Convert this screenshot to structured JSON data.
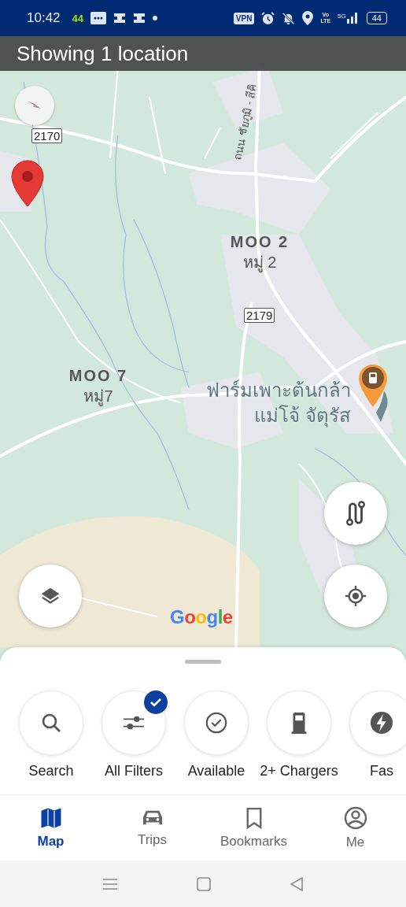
{
  "status_bar": {
    "time": "10:42",
    "data_badge": "44",
    "vpn": "VPN",
    "volte_top": "Vo",
    "volte_bottom": "LTE",
    "network": "5G",
    "battery": "44"
  },
  "banner": {
    "text": "Showing 1 location"
  },
  "map": {
    "road_name": "ถนน ชัยภูมิ - สีคิ",
    "road_shields": [
      {
        "text": "2170"
      },
      {
        "text": "2179"
      }
    ],
    "places": [
      {
        "name": "MOO 2",
        "local_name": "หมู่ 2"
      },
      {
        "name": "MOO 7",
        "local_name": "หมู่7"
      }
    ],
    "poi": {
      "line_1": "ฟาร์มเพาะต้นกล้า",
      "line_2": "แม่โจ้ จัตุรัส"
    },
    "attribution": "Google"
  },
  "filters": [
    {
      "label": "Search",
      "kind": "search",
      "active": false
    },
    {
      "label": "All Filters",
      "kind": "sliders",
      "active": true
    },
    {
      "label": "Available",
      "kind": "check",
      "active": false
    },
    {
      "label": "2+ Chargers",
      "kind": "charger",
      "active": false
    },
    {
      "label": "Fas",
      "kind": "bolt",
      "active": false
    }
  ],
  "nav": [
    {
      "label": "Map",
      "kind": "map",
      "selected": true
    },
    {
      "label": "Trips",
      "kind": "car",
      "selected": false
    },
    {
      "label": "Bookmarks",
      "kind": "bookmark",
      "selected": false
    },
    {
      "label": "Me",
      "kind": "person",
      "selected": false
    }
  ]
}
